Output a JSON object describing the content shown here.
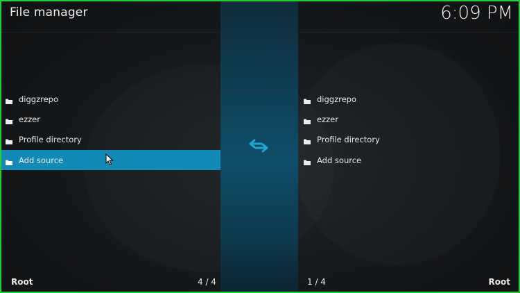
{
  "header": {
    "title": "File manager",
    "clock": "6:09 PM"
  },
  "left_pane": {
    "items": [
      {
        "label": "diggzrepo",
        "icon": "folder-icon"
      },
      {
        "label": "ezzer",
        "icon": "folder-icon"
      },
      {
        "label": "Profile directory",
        "icon": "folder-icon"
      },
      {
        "label": "Add source",
        "icon": "folder-icon",
        "focused": true
      }
    ],
    "footer_path": "Root",
    "footer_count": "4 / 4"
  },
  "right_pane": {
    "items": [
      {
        "label": "diggzrepo",
        "icon": "folder-icon"
      },
      {
        "label": "ezzer",
        "icon": "folder-icon"
      },
      {
        "label": "Profile directory",
        "icon": "folder-icon"
      },
      {
        "label": "Add source",
        "icon": "folder-icon"
      }
    ],
    "footer_path": "Root",
    "footer_count": "1 / 4"
  },
  "center": {
    "icon": "swap-arrows-icon"
  },
  "colors": {
    "focus": "#128ab5",
    "accent_icon": "#1fa6d4",
    "border": "#1fcf32"
  }
}
